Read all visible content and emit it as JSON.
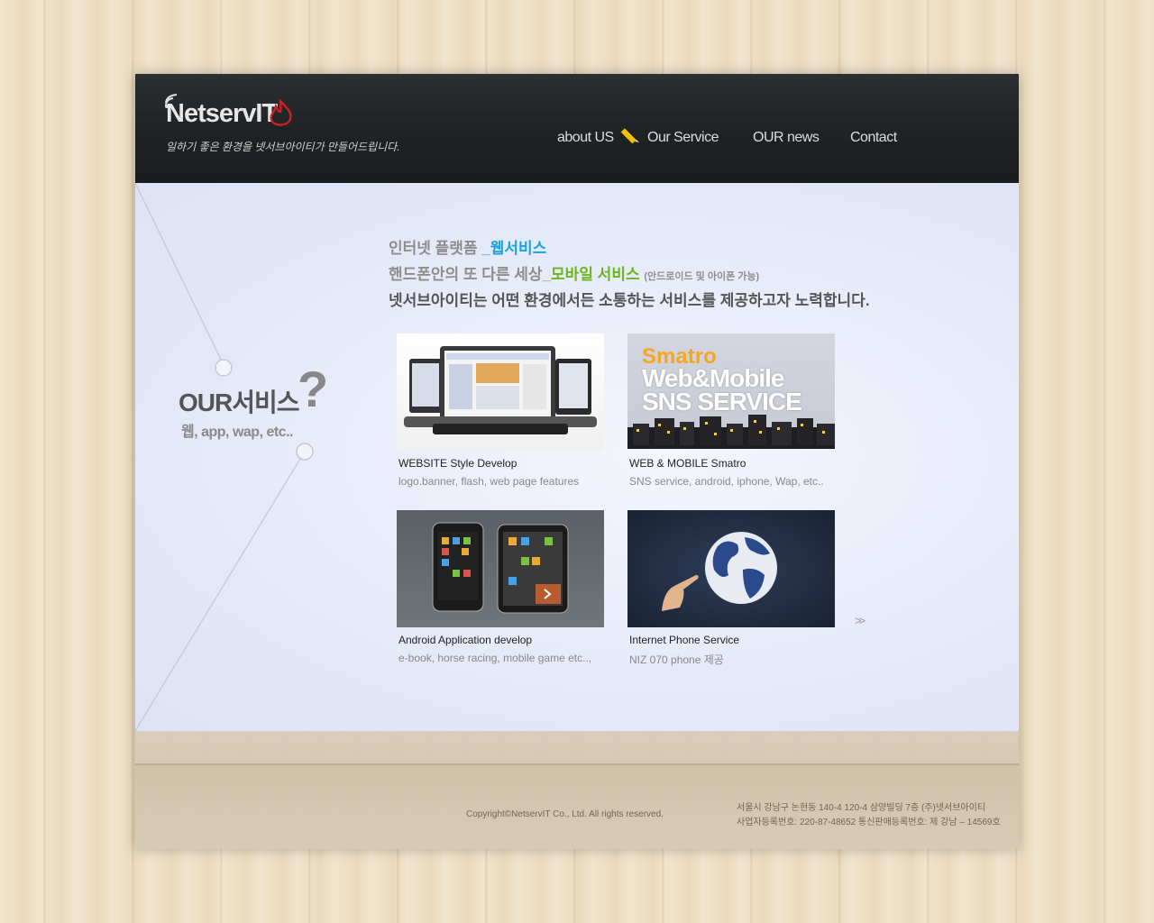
{
  "brand": {
    "logo": "NetservIT",
    "tagline": "일하기 좋은 환경을 넷서브아이티가 만들어드립니다."
  },
  "nav": {
    "items": [
      {
        "label": "about US"
      },
      {
        "label": "Our Service"
      },
      {
        "label": "OUR news"
      },
      {
        "label": "Contact"
      }
    ]
  },
  "sidebar": {
    "title": "OUR서비스",
    "question_mark": "?",
    "subtitle": "웹, app, wap, etc.."
  },
  "intro": {
    "line1_prefix": "인터넷 플랫폼 ",
    "line1_highlight": "_웹서비스",
    "line2_prefix": "핸드폰안의 또 다른 세상",
    "line2_highlight": "_모바일 서비스",
    "line2_note": "(안드로이드 및 아이폰 가능)",
    "line3": "넷서브아이티는 어떤 환경에서든 소통하는 서비스를 제공하고자 노력합니다."
  },
  "services": [
    {
      "title": "WEBSITE Style Develop",
      "desc": "logo.banner, flash, web page features",
      "thumb": "devices-image"
    },
    {
      "title": "WEB & MOBILE Smatro",
      "desc": "SNS service, android, iphone, Wap, etc..",
      "thumb": "smatro-banner-image",
      "banner": {
        "brand": "Smatro",
        "line1": "Web&Mobile",
        "line2": "SNS SERVICE"
      }
    },
    {
      "title": "Android Application develop",
      "desc": "e-book, horse racing, mobile game etc..,",
      "thumb": "phone-tablet-image"
    },
    {
      "title": "Internet Phone Service",
      "desc": "NIZ 070 phone 제공",
      "thumb": "globe-hand-image"
    }
  ],
  "next_label": ">>",
  "footer": {
    "copyright": "Copyright©NetservIT Co., Ltd. All rights reserved.",
    "address_line1": "서울시 강남구 논현동 140-4 120-4 삼양빌딩 7층 (주)넷서브아이티",
    "address_line2": "사업자등록번호: 220-87-48652 통신판매등록번호: 제 강남 – 14569호"
  },
  "colors": {
    "header_bg": "#1e2123",
    "content_bg": "#e5e9f8",
    "web_highlight": "#1aa3e0",
    "mobile_highlight": "#6bb520",
    "smatro_orange": "#f5a623"
  }
}
